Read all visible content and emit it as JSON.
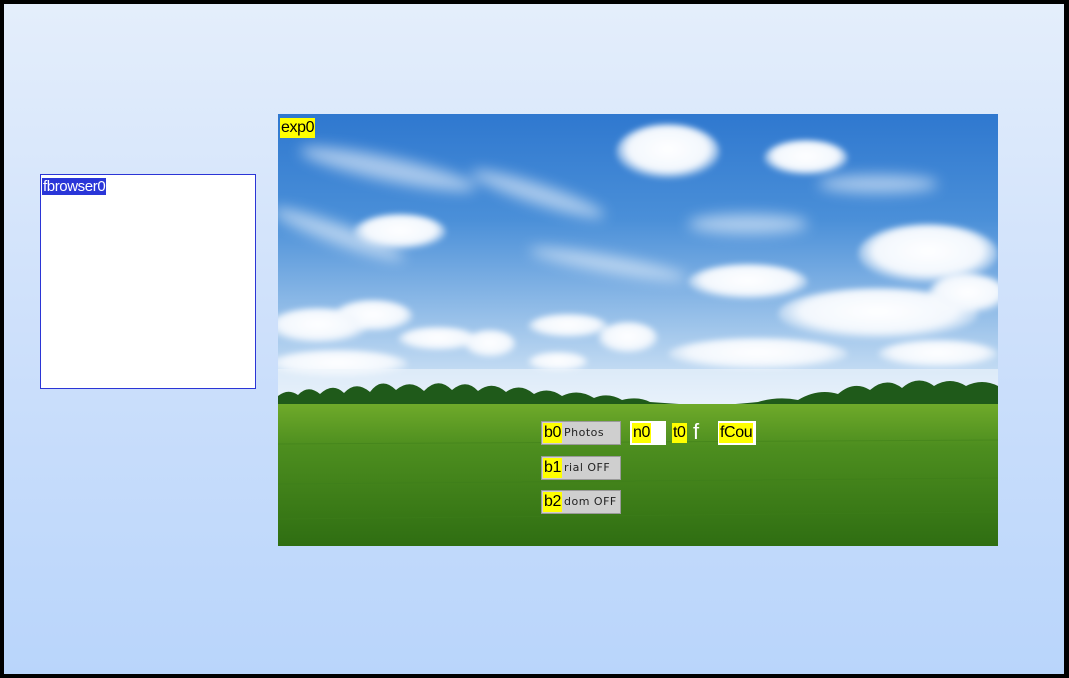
{
  "file_browser": {
    "id_label": "fbrowser0"
  },
  "explorer": {
    "id_label": "exp0",
    "buttons": [
      {
        "id_label": "b0",
        "text": "Photos"
      },
      {
        "id_label": "b1",
        "text": "rial OFF"
      },
      {
        "id_label": "b2",
        "text": "dom OFF"
      }
    ],
    "number": {
      "id_label": "n0",
      "value": ""
    },
    "text_field": {
      "id_label": "t0",
      "value": "f"
    },
    "extra_field": {
      "id_label": "fCou"
    }
  },
  "colors": {
    "background_top": "#e4eefb",
    "background_bottom": "#b9d5fb",
    "tag_yellow": "#ffff00",
    "fbrowser_blue": "#2a36d8",
    "button_gray": "#cfcfcf"
  }
}
